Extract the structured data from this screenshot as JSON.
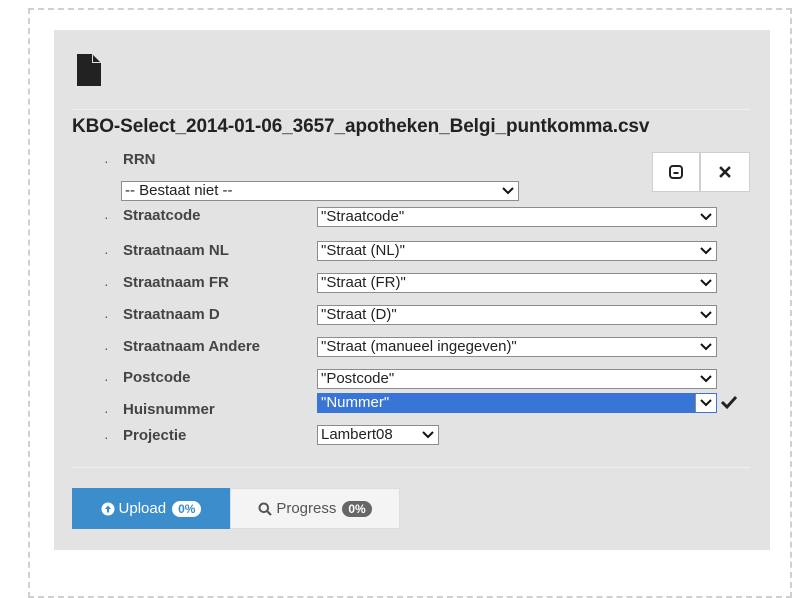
{
  "file": {
    "name": "KBO-Select_2014-01-06_3657_apotheken_Belgi_puntkomma.csv"
  },
  "fields": [
    {
      "label": "RRN",
      "value": "-- Bestaat niet --"
    },
    {
      "label": "Straatcode",
      "value": "\"Straatcode\""
    },
    {
      "label": "Straatnaam NL",
      "value": "\"Straat (NL)\""
    },
    {
      "label": "Straatnaam FR",
      "value": "\"Straat (FR)\""
    },
    {
      "label": "Straatnaam D",
      "value": "\"Straat (D)\""
    },
    {
      "label": "Straatnaam Andere",
      "value": "\"Straat (manueel ingegeven)\""
    },
    {
      "label": "Postcode",
      "value": "\"Postcode\""
    },
    {
      "label": "Huisnummer",
      "value": "\"Nummer\""
    },
    {
      "label": "Projectie",
      "value": "Lambert08"
    }
  ],
  "bullet": "·",
  "buttons": {
    "upload_label": "Upload",
    "upload_badge": "0%",
    "progress_label": "Progress",
    "progress_badge": "0%"
  },
  "icons": {
    "file": "file-icon",
    "minimize": "minimize-icon",
    "close": "close-icon",
    "check": "check-icon",
    "upload": "upload-icon",
    "search": "search-icon"
  },
  "colors": {
    "panel": "#e3e3e3",
    "primary": "#3c8dcc",
    "selected": "#3875d7"
  }
}
